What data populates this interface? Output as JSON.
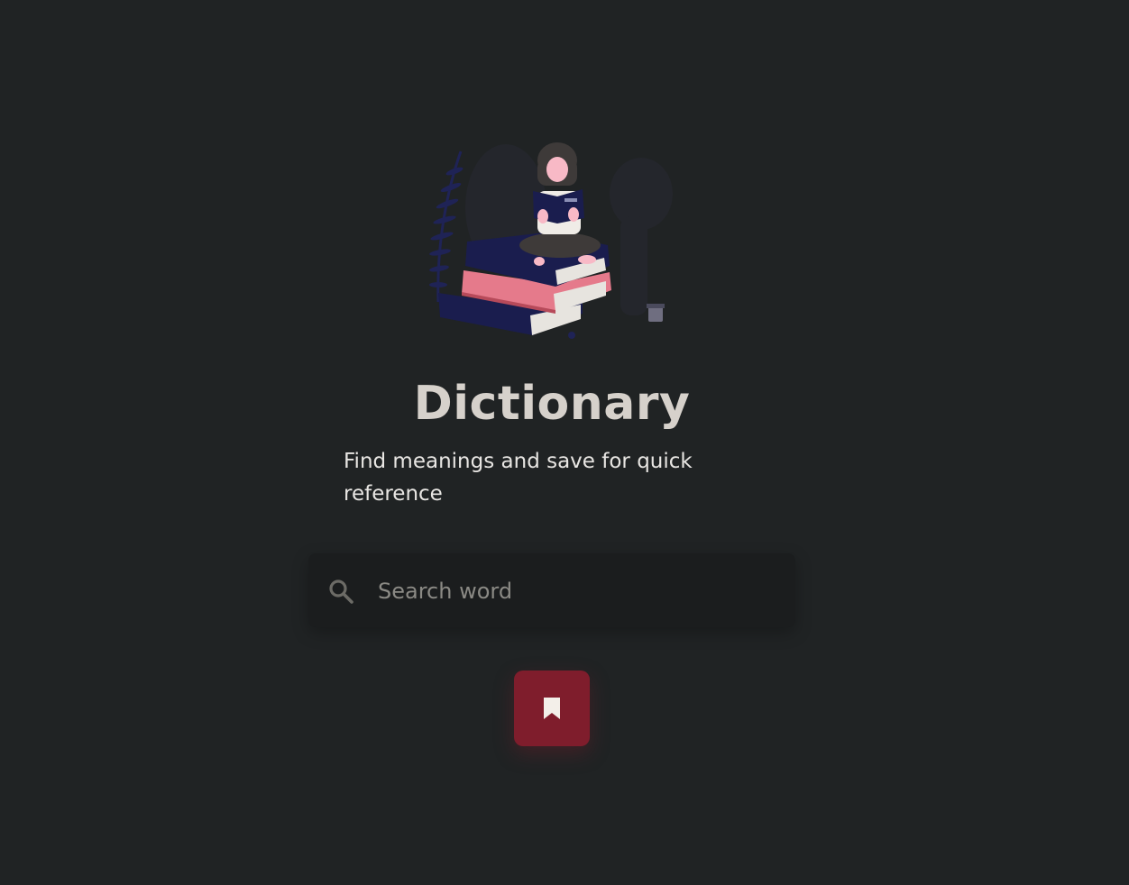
{
  "app": {
    "title": "Dictionary",
    "subtitle": "Find meanings and save for quick reference"
  },
  "hero": {
    "illustration": "woman-reading-on-books-illustration"
  },
  "search": {
    "placeholder": "Search word",
    "value": "",
    "icon": "search-icon"
  },
  "bookmark_button": {
    "icon": "bookmark-icon"
  },
  "colors": {
    "background": "#202324",
    "accent": "#7f1d2c",
    "title": "#d6d1cb",
    "search_bg": "#1b1d1e"
  }
}
